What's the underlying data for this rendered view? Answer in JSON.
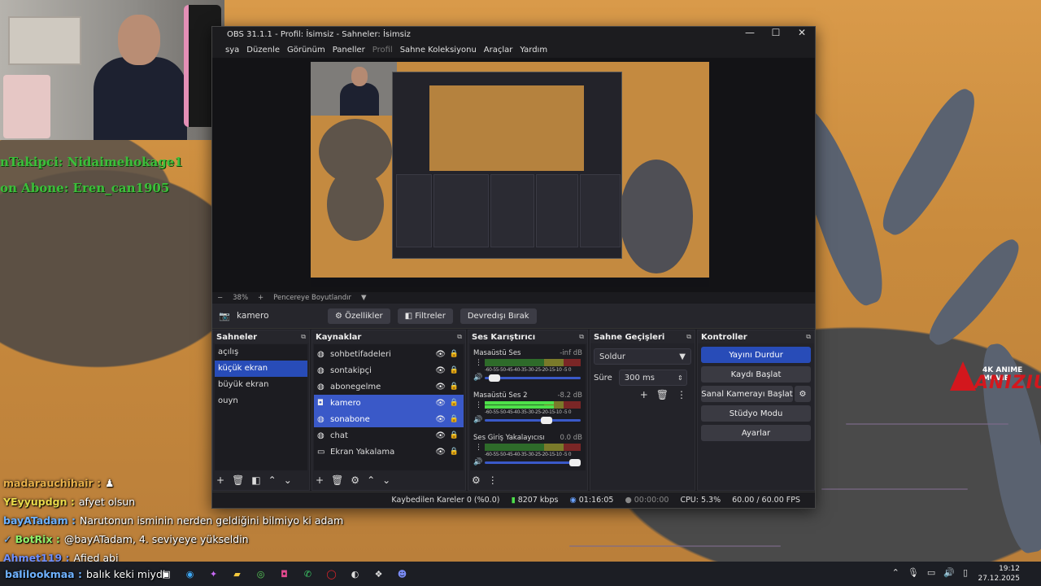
{
  "obs": {
    "title": "OBS 31.1.1 - Profil: İsimsiz - Sahneler: İsimsiz",
    "window_controls": [
      "—",
      "☐",
      "✕"
    ],
    "menu": [
      "sya",
      "Düzenle",
      "Görünüm",
      "Paneller",
      "Profil",
      "Sahne Koleksiyonu",
      "Araçlar",
      "Yardım"
    ],
    "zoom": {
      "minus": "−",
      "percent": "38%",
      "plus": "+",
      "fit": "Pencereye Boyutlandır",
      "arrow": "▼"
    },
    "source_bar": {
      "source_name": "kamero",
      "properties": "⚙ Özellikler",
      "filters": "◧ Filtreler",
      "deactivate": "Devredışı Bırak"
    },
    "scenes": {
      "title": "Sahneler",
      "items": [
        "açılış",
        "küçük ekran",
        "büyük ekran",
        "ouyn"
      ],
      "selected": 1
    },
    "sources": {
      "title": "Kaynaklar",
      "items": [
        {
          "name": "sohbetifadeleri",
          "icon": "globe-icon"
        },
        {
          "name": "sontakipçi",
          "icon": "globe-icon"
        },
        {
          "name": "abonegelme",
          "icon": "globe-icon"
        },
        {
          "name": "kamero",
          "icon": "camera-icon"
        },
        {
          "name": "sonabone",
          "icon": "globe-icon"
        },
        {
          "name": "chat",
          "icon": "globe-icon"
        },
        {
          "name": "Ekran Yakalama",
          "icon": "monitor-icon"
        }
      ]
    },
    "mixer": {
      "title": "Ses Karıştırıcı",
      "ticks": "-60-55-50-45-40-35-30-25-20-15-10 -5 0",
      "channels": [
        {
          "name": "Masaüstü Ses",
          "db": "-inf dB",
          "level": 0.0,
          "fader": 0.05
        },
        {
          "name": "Masaüstü Ses 2",
          "db": "-8.2 dB",
          "level": 0.72,
          "fader": 0.66
        },
        {
          "name": "Ses Giriş Yakalayıcısı",
          "db": "0.0 dB",
          "level": 0.0,
          "fader": 1.0
        }
      ]
    },
    "transitions": {
      "title": "Sahne Geçişleri",
      "type": "Soldur",
      "duration_label": "Süre",
      "duration": "300 ms"
    },
    "controls": {
      "title": "Kontroller",
      "stop_stream": "Yayını Durdur",
      "start_record": "Kaydı Başlat",
      "virtual_cam": "Sanal Kamerayı Başlat",
      "studio": "Stüdyo Modu",
      "settings": "Ayarlar"
    },
    "status": {
      "dropped": "Kaybedilen Kareler 0 (%0.0)",
      "bitrate": "8207 kbps",
      "stream_time": "01:16:05",
      "record_time": "00:00:00",
      "cpu": "CPU: 5.3%",
      "fps": "60.00 / 60.00 FPS"
    }
  },
  "overlay": {
    "last_follower": "nTakipci: Nidaimehokage1",
    "last_sub": "on Abone: Eren_can1905"
  },
  "brand": {
    "top": "4K ANIME MOVIE",
    "name": "ANIZIUM"
  },
  "chat": [
    {
      "user": "madarauchihair :",
      "msg": "",
      "color": "#e8b04a"
    },
    {
      "user": "YEyyupdgn :",
      "msg": "afyet olsun",
      "color": "#e8d94a"
    },
    {
      "user": "bayATadam :",
      "msg": "Narutonun isminin nerden geldiğini bilmiyo ki adam",
      "color": "#6fb2ff"
    },
    {
      "user": "BotRix :",
      "msg": "@bayATadam, 4. seviyeye yükseldin",
      "color": "#8ef06a"
    },
    {
      "user": "Ahmet119 :",
      "msg": "Afied abi",
      "color": "#6f8fff"
    },
    {
      "user": "balilookmaa :",
      "msg": "balık keki miydi",
      "color": "#6fb2ff"
    }
  ],
  "taskbar": {
    "time": "19:12",
    "date": "27.12.2025"
  },
  "colors": {
    "accent": "#284cb8",
    "selected": "#3a59c8",
    "meter_green": "#4ee04a"
  }
}
